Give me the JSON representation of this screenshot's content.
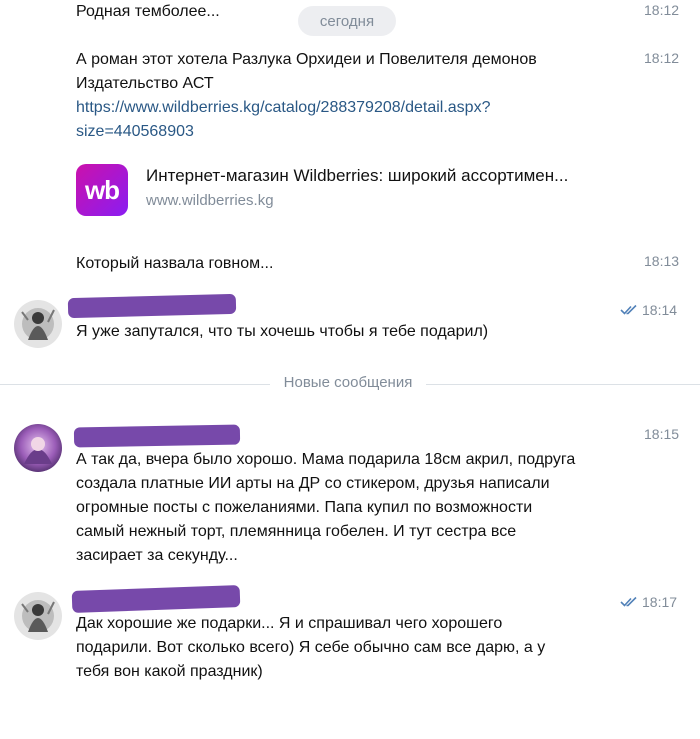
{
  "date_divider": "сегодня",
  "messages": [
    {
      "text": "Родная темболее...",
      "time": "18:12"
    },
    {
      "lines": [
        "А роман этот хотела Разлука Орхидеи и Повелителя демонов",
        "Издательство АСТ"
      ],
      "link_lines": [
        "https://www.wildberries.kg/catalog/288379208/detail.aspx?",
        "size=440568903"
      ],
      "time": "18:12"
    },
    {
      "text": "Который назвала говном...",
      "time": "18:13"
    },
    {
      "text": "Я уже запутался, что ты хочешь чтобы я тебе подарил)",
      "time": "18:14"
    },
    {
      "lines": [
        "А так да, вчера было хорошо. Мама подарила 18см акрил, подруга",
        "создала платные ИИ арты на ДР со стикером, друзья написали",
        "огромные посты с пожеланиями. Папа купил по возможности",
        "самый нежный торт, племянница гобелен. И тут сестра все",
        "засирает за секунду..."
      ],
      "time": "18:15"
    },
    {
      "lines": [
        "Дак хорошие же подарки... Я и спрашивал чего хорошего",
        "подарили. Вот сколько всего) Я себе обычно сам все дарю, а у",
        "тебя вон какой праздник)"
      ],
      "time": "18:17"
    }
  ],
  "link_preview": {
    "logo_text": "wb",
    "title": "Интернет-магазин Wildberries: широкий ассортимен...",
    "domain": "www.wildberries.kg"
  },
  "new_messages_divider": "Новые сообщения",
  "colors": {
    "link": "#2a5885",
    "meta": "#818c99",
    "check": "#5181b8",
    "wb_brand": "#cb11ab",
    "redaction": "#6b3aa3"
  },
  "icons": {
    "read_status": "double-check-icon"
  }
}
